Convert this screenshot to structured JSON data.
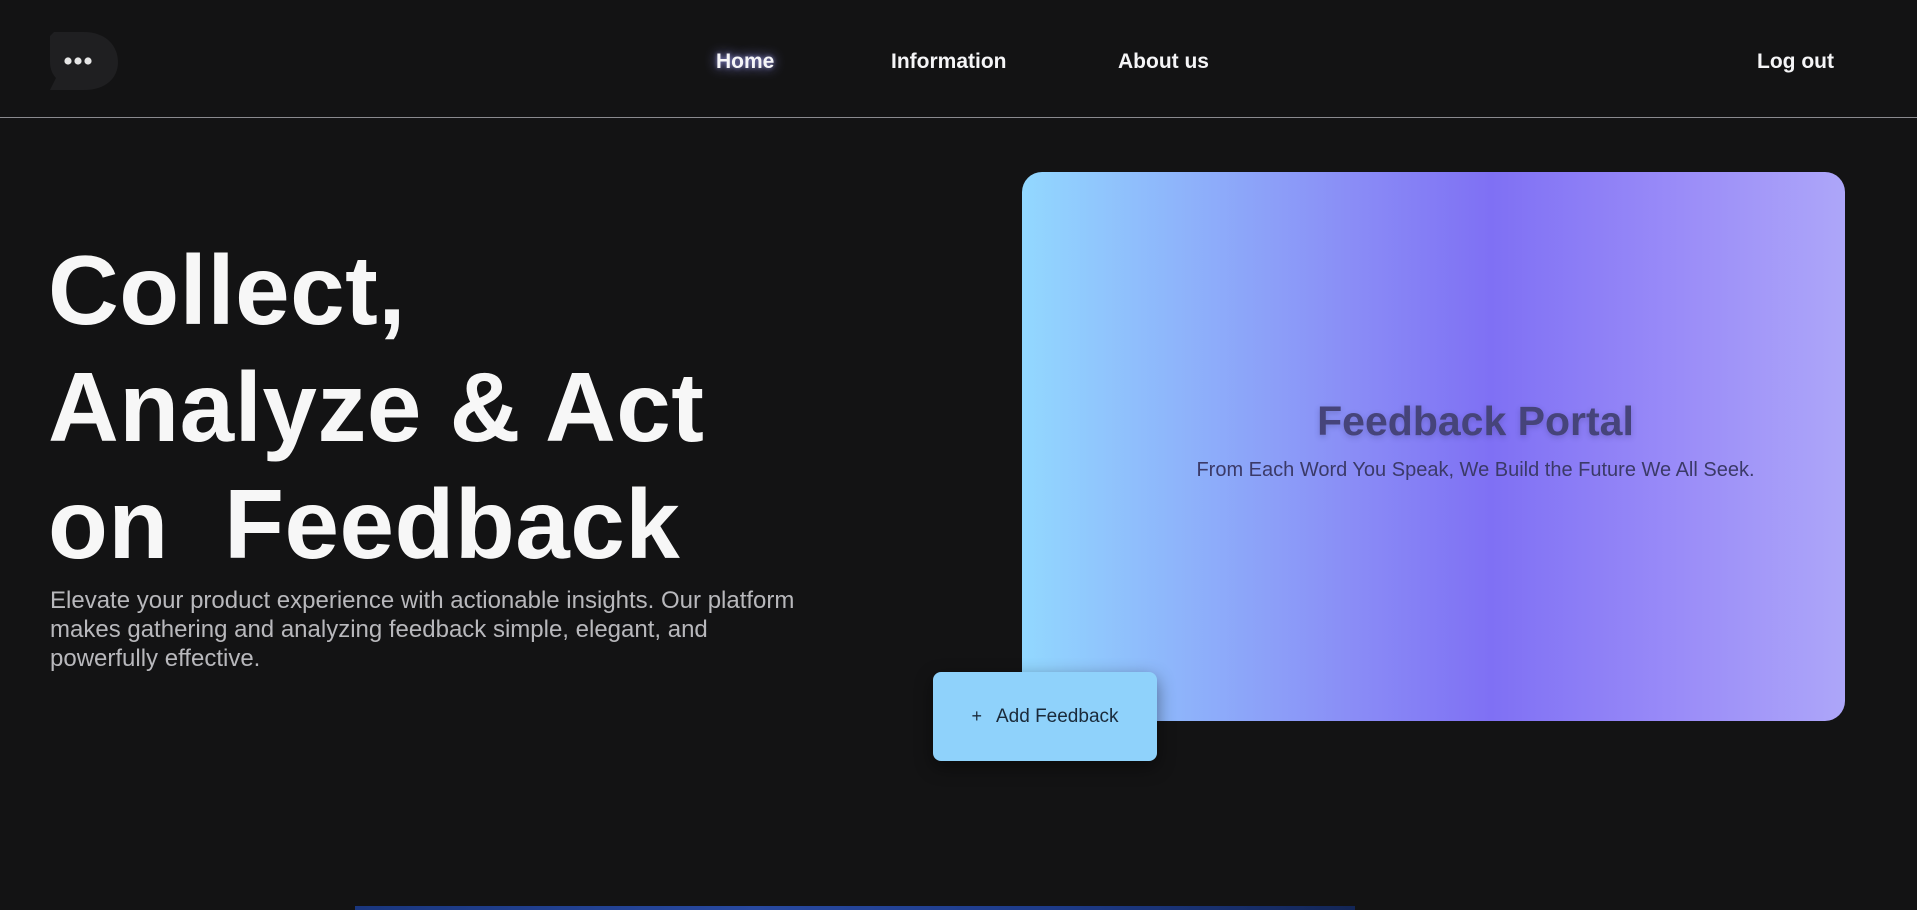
{
  "nav": {
    "links": [
      "Home",
      "Information",
      "About us"
    ],
    "logout": "Log out",
    "logo_icon": "speech-bubble-d-logo-icon"
  },
  "hero": {
    "title_lines": [
      "Collect,",
      "Analyze & Act",
      "on  Feedback"
    ],
    "description": "Elevate your product experience with actionable insights. Our platform makes gathering and analyzing feedback simple, elegant, and powerfully effective."
  },
  "portal": {
    "title": "Feedback Portal",
    "subtitle": "From Each Word You Speak, We Build the Future We All Seek."
  },
  "add_button": {
    "icon": "+",
    "label": "Add Feedback"
  },
  "colors": {
    "background": "#131314",
    "button": "#8fd2fb",
    "gradient_start": "#92d8ff",
    "gradient_mid": "#7f70f4",
    "gradient_end": "#ada6f9"
  }
}
